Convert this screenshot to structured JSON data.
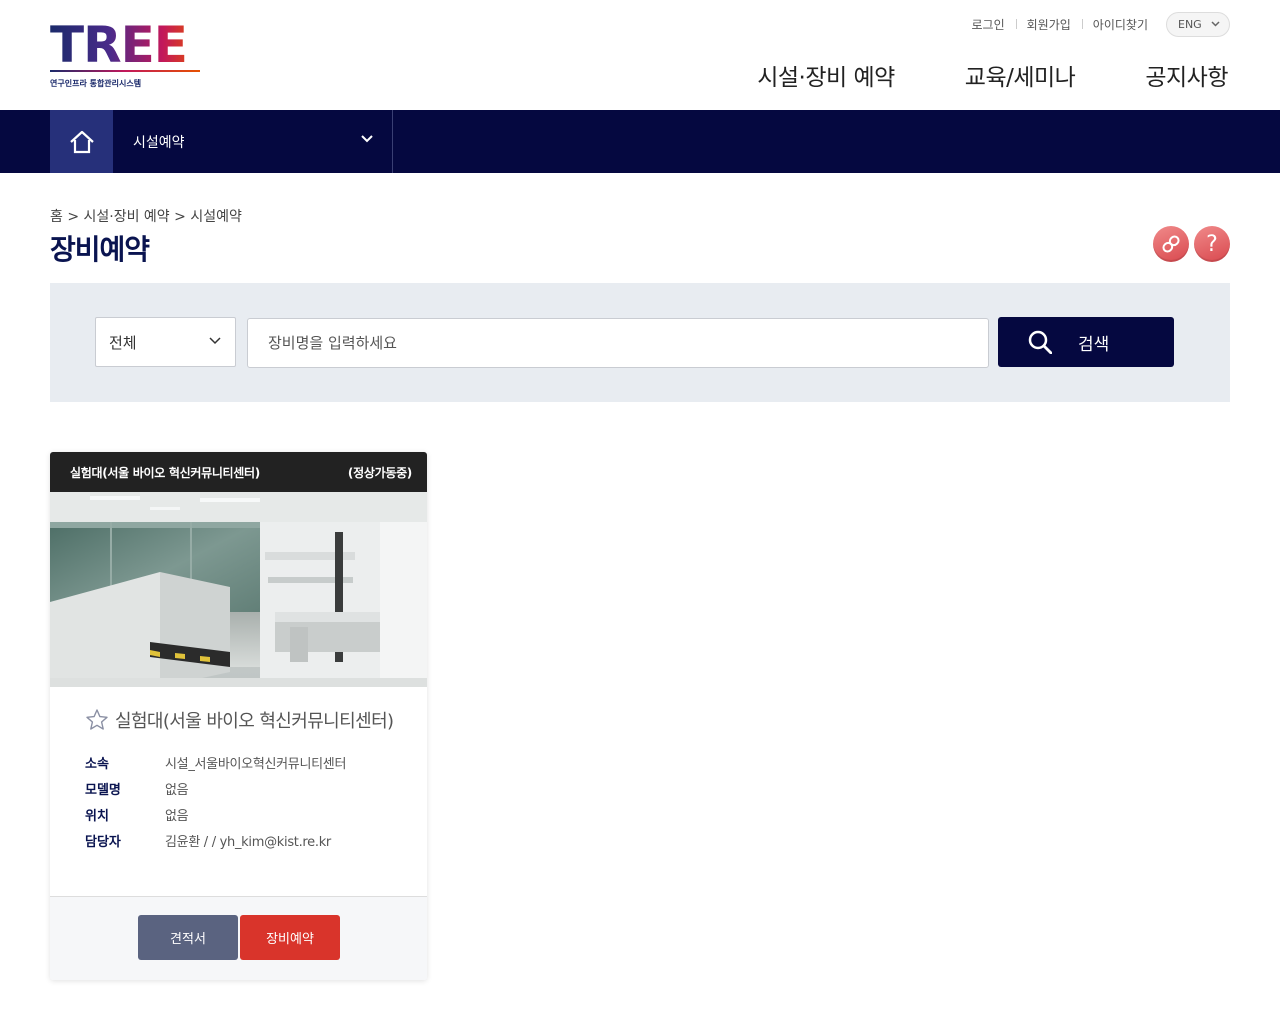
{
  "logo": {
    "word": "TREE",
    "subtitle": "연구인프라 통합관리시스템"
  },
  "util": {
    "login": "로그인",
    "signup": "회원가입",
    "find_id": "아이디찾기",
    "lang": "ENG"
  },
  "gnb": [
    "시설·장비 예약",
    "교육/세미나",
    "공지사항"
  ],
  "navbar": {
    "select_label": "시설예약"
  },
  "breadcrumb": "홈 > 시설·장비 예약 > 시설예약",
  "page_title": "장비예약",
  "search": {
    "category": "전체",
    "placeholder": "장비명을 입력하세요",
    "button": "검색"
  },
  "card": {
    "head_title": "실험대(서울 바이오 혁신커뮤니티센터)",
    "status": "(정상가동중)",
    "name": "실험대(서울 바이오 혁신커뮤니티센터)",
    "info": [
      {
        "k": "소속",
        "v": "시설_서울바이오혁신커뮤니티센터"
      },
      {
        "k": "모델명",
        "v": "없음"
      },
      {
        "k": "위치",
        "v": "없음"
      },
      {
        "k": "담당자",
        "v": "김윤환 / / yh_kim@kist.re.kr"
      }
    ],
    "btn_quote": "견적서",
    "btn_reserve": "장비예약"
  },
  "colors": {
    "navy": "#050840",
    "accent_red": "#d9342b",
    "btn_gray": "#5a6380"
  }
}
